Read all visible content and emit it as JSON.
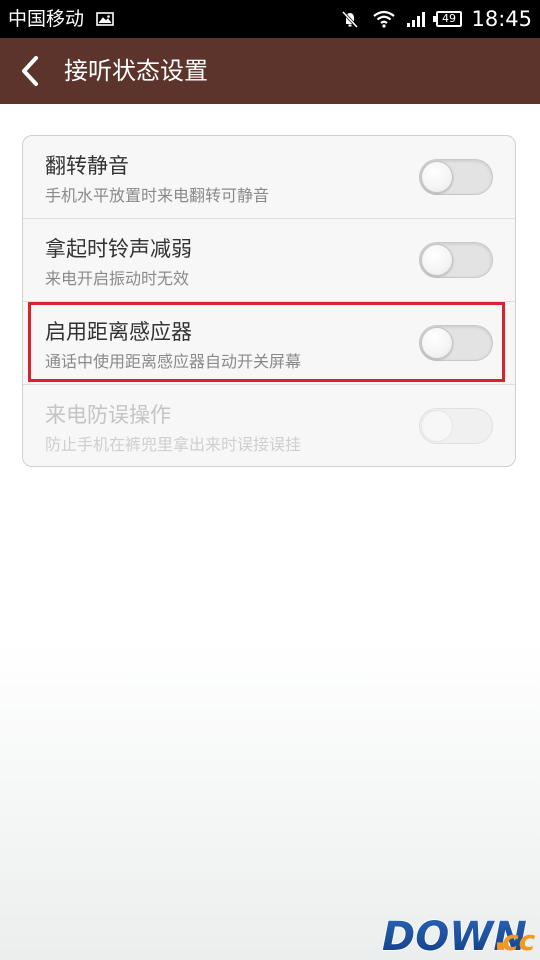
{
  "status_bar": {
    "carrier": "中国移动",
    "battery": "49",
    "time": "18:45",
    "icons": [
      "gallery-icon",
      "mute-icon",
      "wifi-icon",
      "signal-icon",
      "battery-icon"
    ]
  },
  "header": {
    "title": "接听状态设置",
    "back_icon": "chevron-left-icon"
  },
  "settings": [
    {
      "title": "翻转静音",
      "description": "手机水平放置时来电翻转可静音",
      "enabled": false,
      "disabled": false
    },
    {
      "title": "拿起时铃声减弱",
      "description": "来电开启振动时无效",
      "enabled": false,
      "disabled": false
    },
    {
      "title": "启用距离感应器",
      "description": "通话中使用距离感应器自动开关屏幕",
      "enabled": false,
      "disabled": false,
      "highlighted": true
    },
    {
      "title": "来电防误操作",
      "description": "防止手机在裤兜里拿出来时误接误挂",
      "enabled": false,
      "disabled": true
    }
  ],
  "watermark": {
    "text_main": "DOWN",
    "text_dot": ".",
    "text_suffix": "cc"
  },
  "colors": {
    "title_bar": "#5c342b",
    "highlight": "#d8232a",
    "watermark_blue": "#1a4f9c",
    "watermark_orange": "#f29a1f"
  }
}
